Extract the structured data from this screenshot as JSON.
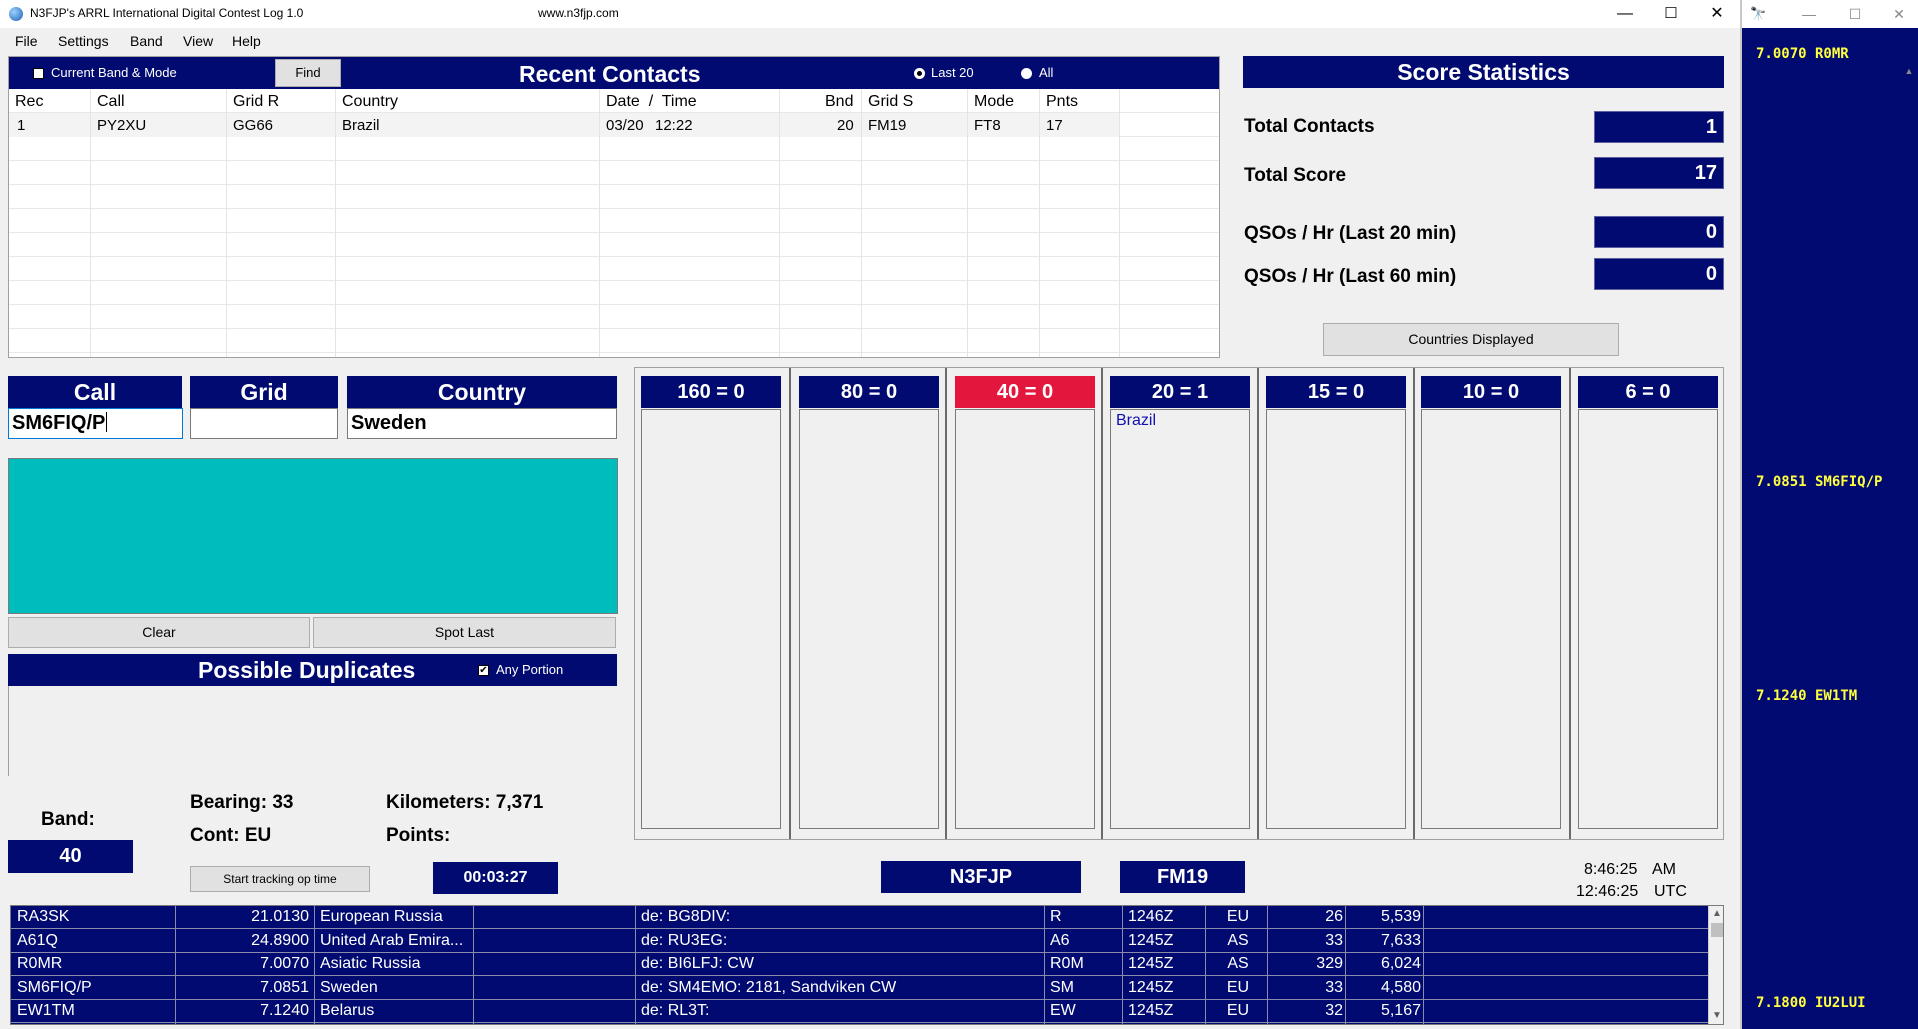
{
  "window": {
    "title": "N3FJP's ARRL International Digital Contest Log 1.0",
    "url": "www.n3fjp.com",
    "minimize": "—",
    "maximize": "☐",
    "close": "✕"
  },
  "menu": [
    "File",
    "Settings",
    "Band",
    "View",
    "Help"
  ],
  "recent": {
    "title": "Recent Contacts",
    "current_band_label": "Current Band & Mode",
    "find_label": "Find",
    "last20_label": "Last 20",
    "all_label": "All",
    "headers": [
      "Rec",
      "Call",
      "Grid R",
      "Country",
      "Date  /  Time",
      "Bnd",
      "Grid S",
      "Mode",
      "Pnts"
    ],
    "rows": [
      {
        "rec": "1",
        "call": "PY2XU",
        "grid_r": "GG66",
        "country": "Brazil",
        "date": "03/20",
        "time": "12:22",
        "bnd": "20",
        "grid_s": "FM19",
        "mode": "FT8",
        "pnts": "17"
      }
    ]
  },
  "score": {
    "title": "Score Statistics",
    "total_contacts_label": "Total Contacts",
    "total_contacts": "1",
    "total_score_label": "Total Score",
    "total_score": "17",
    "qso20_label": "QSOs / Hr (Last 20 min)",
    "qso20": "0",
    "qso60_label": "QSOs / Hr (Last 60 min)",
    "qso60": "0",
    "countries_button": "Countries Displayed"
  },
  "entry": {
    "call_label": "Call",
    "call_value": "SM6FIQ/P",
    "grid_label": "Grid",
    "grid_value": "",
    "country_label": "Country",
    "country_value": "Sweden",
    "clear_label": "Clear",
    "spot_last_label": "Spot Last"
  },
  "duplicates": {
    "title": "Possible Duplicates",
    "any_portion_label": "Any Portion",
    "check_mark": "✔"
  },
  "bands": [
    {
      "label": "160 = 0",
      "items": []
    },
    {
      "label": "80 = 0",
      "items": []
    },
    {
      "label": "40 = 0",
      "items": [],
      "active": true
    },
    {
      "label": "20 = 1",
      "items": [
        "Brazil"
      ]
    },
    {
      "label": "15 = 0",
      "items": []
    },
    {
      "label": "10 = 0",
      "items": []
    },
    {
      "label": "6 = 0",
      "items": []
    }
  ],
  "info": {
    "band_label": "Band:",
    "band_value": "40",
    "bearing": "Bearing: 33",
    "cont": "Cont: EU",
    "kilometers": "Kilometers: 7,371",
    "points": "Points:",
    "op_time_button": "Start tracking op time",
    "timer": "00:03:27",
    "my_call": "N3FJP",
    "my_grid": "FM19",
    "local_time": "8:46:25",
    "local_ampm": "AM",
    "utc_time": "12:46:25",
    "utc_label": "UTC"
  },
  "spots": [
    {
      "call": "RA3SK",
      "freq": "21.0130",
      "country": "European Russia",
      "extra": "",
      "comment": "de: BG8DIV:",
      "prefix": "R",
      "time": "1246Z",
      "cont": "EU",
      "bearing": "26",
      "dist": "5,539"
    },
    {
      "call": "A61Q",
      "freq": "24.8900",
      "country": "United Arab Emira...",
      "extra": "",
      "comment": "de: RU3EG:",
      "prefix": "A6",
      "time": "1245Z",
      "cont": "AS",
      "bearing": "33",
      "dist": "7,633"
    },
    {
      "call": "R0MR",
      "freq": "7.0070",
      "country": "Asiatic Russia",
      "extra": "",
      "comment": "de: BI6LFJ: CW",
      "prefix": "R0M",
      "time": "1245Z",
      "cont": "AS",
      "bearing": "329",
      "dist": "6,024"
    },
    {
      "call": "SM6FIQ/P",
      "freq": "7.0851",
      "country": "Sweden",
      "extra": "",
      "comment": "de: SM4EMO: 2181, Sandviken CW",
      "prefix": "SM",
      "time": "1245Z",
      "cont": "EU",
      "bearing": "33",
      "dist": "4,580"
    },
    {
      "call": "EW1TM",
      "freq": "7.1240",
      "country": "Belarus",
      "extra": "",
      "comment": "de: RL3T:",
      "prefix": "EW",
      "time": "1245Z",
      "cont": "EU",
      "bearing": "32",
      "dist": "5,167"
    }
  ],
  "bandmap": {
    "icon": "🔭",
    "minimize": "—",
    "maximize": "☐",
    "close": "✕",
    "spots": [
      "7.0070 R0MR",
      "7.0851 SM6FIQ/P",
      "7.1240 EW1TM",
      "7.1800 IU2LUI"
    ]
  },
  "colors": {
    "navy": "#000a70",
    "teal": "#00bdbd",
    "active_band": "#e3163d",
    "bandmap_text": "#ffff40"
  }
}
